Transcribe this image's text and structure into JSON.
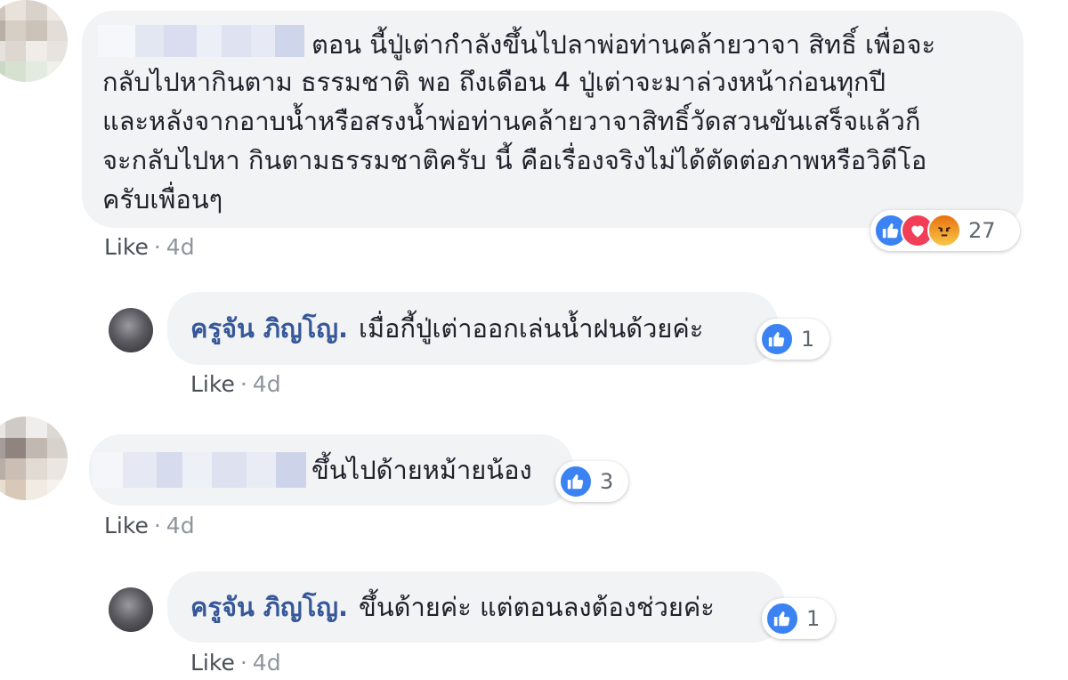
{
  "comments": [
    {
      "text_lines": [
        "ตอน นี้ปู่เต่ากำลังขึ้นไปลาพ่อท่านคล้ายวาจา สิทธิ์ เพื่อจะ",
        "กลับไปหากินตาม ธรรมชาติ พอ ถึงเดือน 4 ปู่เต่าจะมาล่วงหน้าก่อนทุกปี",
        "และหลังจากอาบน้ำหรือสรงน้ำพ่อท่านคล้ายวาจาสิทธิ์วัดสวนขันเสร็จแล้วก็",
        "จะกลับไปหา กินตามธรรมชาติครับ นี้ คือเรื่องจริงไม่ได้ตัดต่อภาพหรือวิดีโอ",
        "ครับเพื่อนๆ"
      ],
      "reactions": [
        "like-icon",
        "love-icon",
        "angry-icon"
      ],
      "reaction_count": "27",
      "like_label": "Like",
      "age": "4d"
    },
    {
      "author": "ครูจัน ภิญโญ.",
      "text": "เมื่อกี้ปู่เต่าออกเล่นน้ำฝนด้วยค่ะ",
      "reactions": [
        "like-icon"
      ],
      "reaction_count": "1",
      "like_label": "Like",
      "age": "4d"
    },
    {
      "text": "ขึ้นไปด้ายหม้ายน้อง",
      "reactions": [
        "like-icon"
      ],
      "reaction_count": "3",
      "like_label": "Like",
      "age": "4d"
    },
    {
      "author": "ครูจัน ภิญโญ.",
      "text": "ขึ้นด้ายค่ะ แต่ตอนลงต้องช่วยค่ะ",
      "reactions": [
        "like-icon"
      ],
      "reaction_count": "1",
      "like_label": "Like",
      "age": "4d"
    }
  ],
  "meta_separator": "·",
  "colors": {
    "bubble": "#f2f3f5",
    "author": "#365899",
    "like_reaction": "#3b82f2",
    "love_reaction": "#f33e58",
    "angry_reaction": "#e9710f"
  }
}
